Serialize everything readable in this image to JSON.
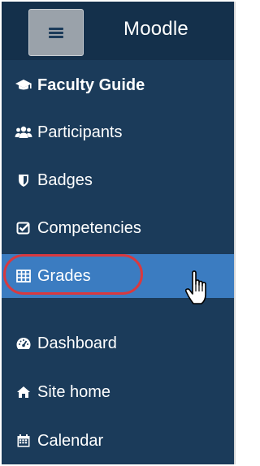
{
  "header": {
    "menu_icon": "hamburger-icon",
    "brand": "Moodle"
  },
  "nav": {
    "items": [
      {
        "label": "Faculty Guide",
        "icon": "graduation-cap-icon"
      },
      {
        "label": "Participants",
        "icon": "users-icon"
      },
      {
        "label": "Badges",
        "icon": "shield-icon"
      },
      {
        "label": "Competencies",
        "icon": "checkbox-icon"
      },
      {
        "label": "Grades",
        "icon": "table-icon"
      },
      {
        "label": "Dashboard",
        "icon": "dashboard-icon"
      },
      {
        "label": "Site home",
        "icon": "home-icon"
      },
      {
        "label": "Calendar",
        "icon": "calendar-icon"
      }
    ],
    "active_index": 4
  },
  "colors": {
    "navbar": "#14304b",
    "drawer": "#1b3b5a",
    "active": "#3b7cc1",
    "highlight": "#d9393f"
  }
}
